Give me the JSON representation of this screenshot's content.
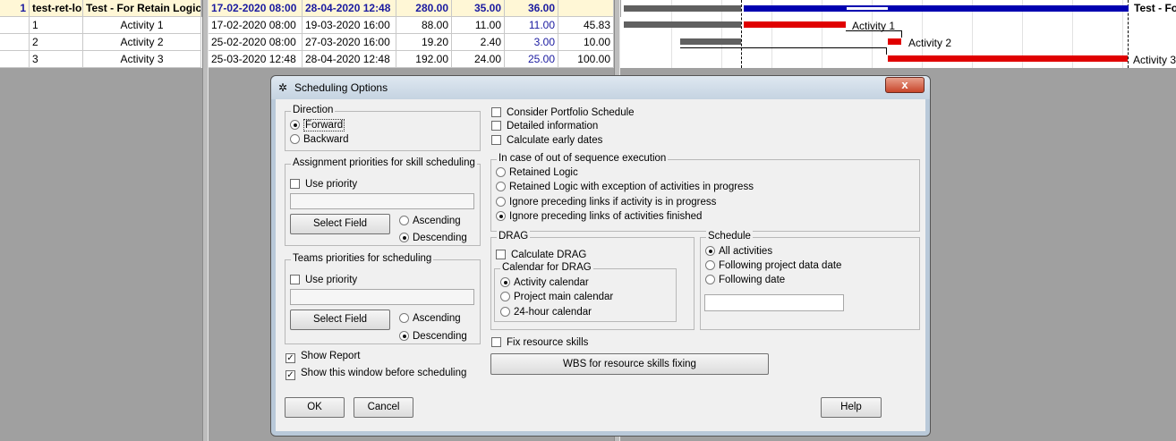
{
  "grid": {
    "header": [
      "1",
      "test-ret-lo",
      "Test - For Retain Logic",
      "17-02-2020  08:00",
      "28-04-2020  12:48",
      "280.00",
      "35.00",
      "36.00",
      ""
    ],
    "rows": [
      [
        "1",
        "Activity 1",
        "17-02-2020  08:00",
        "19-03-2020  16:00",
        "88.00",
        "11.00",
        "11.00",
        "45.83"
      ],
      [
        "2",
        "Activity 2",
        "25-02-2020  08:00",
        "27-03-2020  16:00",
        "19.20",
        "2.40",
        "3.00",
        "10.00"
      ],
      [
        "3",
        "Activity 3",
        "25-03-2020  12:48",
        "28-04-2020  12:48",
        "192.00",
        "24.00",
        "25.00",
        "100.00"
      ]
    ]
  },
  "gantt": {
    "labels": [
      "Test - Fo",
      "Activity 1",
      "Activity 2",
      "Activity 3"
    ],
    "colors": {
      "critical": "#e00000",
      "summary": "#0000b0",
      "baseline": "#606060"
    }
  },
  "dialog": {
    "title": "Scheduling Options",
    "close": "x",
    "direction": {
      "legend": "Direction",
      "forward": "Forward",
      "backward": "Backward",
      "selected": "Forward"
    },
    "assignment": {
      "legend": "Assignment priorities for skill scheduling",
      "use_priority": "Use priority",
      "field_value": "",
      "select_field": "Select Field",
      "ascending": "Ascending",
      "descending": "Descending",
      "selected": "Descending"
    },
    "teams": {
      "legend": "Teams priorities for scheduling",
      "use_priority": "Use priority",
      "field_value": "",
      "select_field": "Select Field",
      "ascending": "Ascending",
      "descending": "Descending",
      "selected": "Descending"
    },
    "show_report": "Show Report",
    "show_window": "Show this window before scheduling",
    "consider_portfolio": "Consider Portfolio Schedule",
    "detailed_info": "Detailed information",
    "calc_early": "Calculate early dates",
    "sequence": {
      "legend": "In case of out of sequence execution",
      "opt1": "Retained Logic",
      "opt2": "Retained Logic with exception of activities in progress",
      "opt3": "Ignore preceding links if activity is in progress",
      "opt4": "Ignore preceding links of activities finished",
      "selected": 4
    },
    "drag": {
      "legend": "DRAG",
      "calculate": "Calculate DRAG",
      "calendar_legend": "Calendar for DRAG",
      "activity_cal": "Activity calendar",
      "project_cal": "Project main calendar",
      "hour24_cal": "24-hour calendar",
      "selected": 1
    },
    "schedule": {
      "legend": "Schedule",
      "all": "All activities",
      "following_project": "Following project data date",
      "following_date": "Following date",
      "date_value": "",
      "selected": 1
    },
    "fix_skills": "Fix resource skills",
    "wbs_button": "WBS for resource skills fixing",
    "ok": "OK",
    "cancel": "Cancel",
    "help": "Help"
  }
}
